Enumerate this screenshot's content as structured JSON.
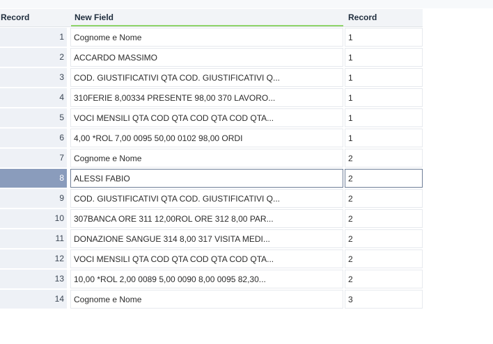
{
  "table": {
    "columns": [
      "Record",
      "New Field",
      "Record"
    ],
    "rows": [
      {
        "n": "1",
        "field": "Cognome e Nome",
        "rec": "1"
      },
      {
        "n": "2",
        "field": "ACCARDO MASSIMO",
        "rec": "1"
      },
      {
        "n": "3",
        "field": "COD. GIUSTIFICATIVI QTA COD. GIUSTIFICATIVI Q...",
        "rec": "1"
      },
      {
        "n": "4",
        "field": "310FERIE 8,00334 PRESENTE 98,00 370 LAVORO...",
        "rec": "1"
      },
      {
        "n": "5",
        "field": "VOCI MENSILI QTA COD QTA COD QTA COD QTA...",
        "rec": "1"
      },
      {
        "n": "6",
        "field": "4,00 *ROL 7,00 0095 50,00 0102 98,00 ORDI",
        "rec": "1"
      },
      {
        "n": "7",
        "field": "Cognome e Nome",
        "rec": "2"
      },
      {
        "n": "8",
        "field": "ALESSI FABIO",
        "rec": "2"
      },
      {
        "n": "9",
        "field": "COD. GIUSTIFICATIVI QTA COD. GIUSTIFICATIVI Q...",
        "rec": "2"
      },
      {
        "n": "10",
        "field": "307BANCA ORE 311 12,00ROL ORE 312 8,00 PAR...",
        "rec": "2"
      },
      {
        "n": "11",
        "field": "DONAZIONE SANGUE 314 8,00 317 VISITA MEDI...",
        "rec": "2"
      },
      {
        "n": "12",
        "field": "VOCI MENSILI QTA COD QTA COD QTA COD QTA...",
        "rec": "2"
      },
      {
        "n": "13",
        "field": "10,00 *ROL 2,00 0089 5,00 0090 8,00 0095 82,30...",
        "rec": "2"
      },
      {
        "n": "14",
        "field": "Cognome e Nome",
        "rec": "3"
      }
    ],
    "selected_row": "8"
  }
}
